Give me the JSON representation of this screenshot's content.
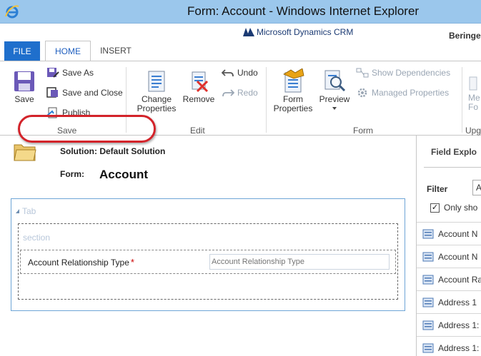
{
  "window": {
    "title": "Form: Account - Windows Internet Explorer"
  },
  "crm": {
    "brand": "Microsoft Dynamics CRM",
    "org": "Beringe"
  },
  "ribbon": {
    "tabs": {
      "file": "FILE",
      "home": "HOME",
      "insert": "INSERT"
    },
    "save": {
      "save": "Save",
      "save_as": "Save As",
      "save_and_close": "Save and Close",
      "publish": "Publish",
      "group": "Save"
    },
    "edit": {
      "change_properties_1": "Change",
      "change_properties_2": "Properties",
      "remove": "Remove",
      "undo": "Undo",
      "redo": "Redo",
      "group": "Edit"
    },
    "form": {
      "form_properties_1": "Form",
      "form_properties_2": "Properties",
      "preview": "Preview",
      "show_dependencies": "Show Dependencies",
      "managed_properties": "Managed Properties",
      "group": "Form"
    },
    "upgrade": {
      "merge_1": "Me",
      "merge_2": "Fo",
      "group": "Upg"
    }
  },
  "form": {
    "solution": "Solution: Default Solution",
    "form_label": "Form:",
    "form_name": "Account",
    "tab_label": "Tab",
    "section_label": "section",
    "field_label": "Account Relationship Type",
    "required_mark": "*",
    "field_placeholder": "Account Relationship Type"
  },
  "explorer": {
    "title": "Field Explo",
    "filter_label": "Filter",
    "filter_value": "A",
    "only_show": "Only sho",
    "checked_mark": "✓",
    "items": [
      {
        "label": "Account N"
      },
      {
        "label": "Account N"
      },
      {
        "label": "Account Ra"
      },
      {
        "label": "Address 1"
      },
      {
        "label": "Address 1:"
      },
      {
        "label": "Address 1:"
      }
    ]
  },
  "colors": {
    "file_tab": "#1f6fcc",
    "titlebar": "#9bc7ec",
    "highlight": "#d3232a",
    "tab_border": "#6ea5d6"
  }
}
